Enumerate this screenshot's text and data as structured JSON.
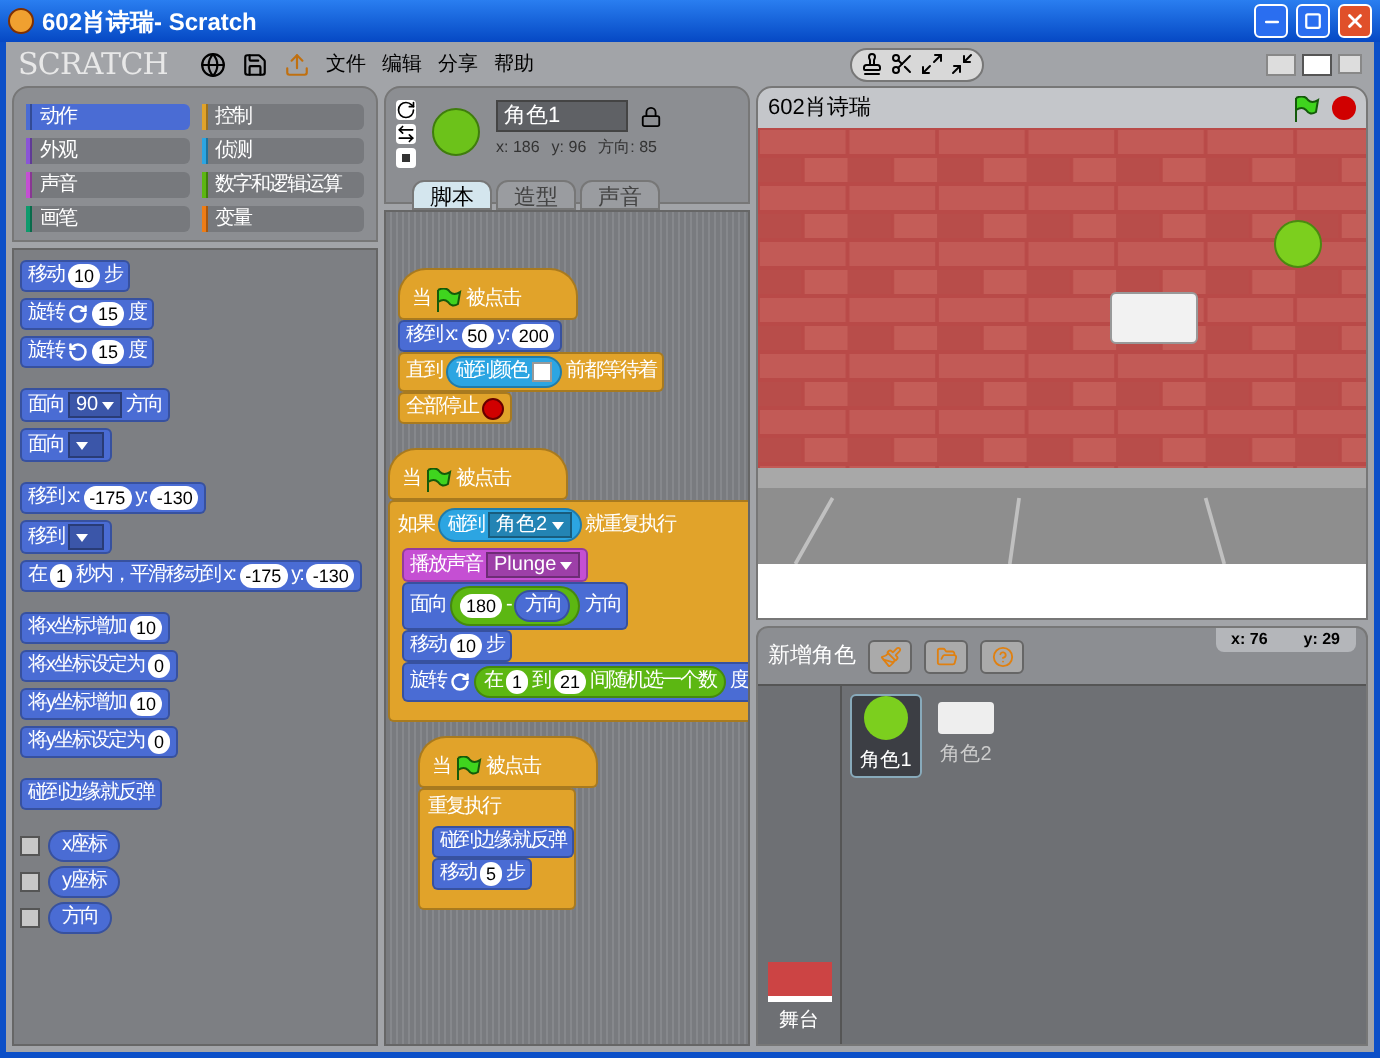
{
  "window": {
    "title": "602肖诗瑞- Scratch"
  },
  "menu_bar": {
    "logo": "SCRATCH",
    "menus": [
      "文件",
      "编辑",
      "分享",
      "帮助"
    ]
  },
  "categories": [
    {
      "label": "动作",
      "color": "#4a6cd4",
      "selected": true
    },
    {
      "label": "控制",
      "color": "#e1a32a",
      "selected": false
    },
    {
      "label": "外观",
      "color": "#8a55d7",
      "selected": false
    },
    {
      "label": "侦测",
      "color": "#2ca5e2",
      "selected": false
    },
    {
      "label": "声音",
      "color": "#c54fd3",
      "selected": false
    },
    {
      "label": "数字和逻辑运算",
      "color": "#5cb712",
      "selected": false
    },
    {
      "label": "画笔",
      "color": "#0e9a6c",
      "selected": false
    },
    {
      "label": "变量",
      "color": "#ee7d16",
      "selected": false
    }
  ],
  "palette": {
    "groups": [
      [
        {
          "kind": "stack",
          "color": "#4a6cd4",
          "parts": [
            {
              "kind": "text",
              "text": "移动"
            },
            {
              "kind": "num",
              "text": "10"
            },
            {
              "kind": "text",
              "text": "步"
            }
          ]
        },
        {
          "kind": "stack",
          "color": "#4a6cd4",
          "parts": [
            {
              "kind": "text",
              "text": "旋转"
            },
            {
              "kind": "turn_cw"
            },
            {
              "kind": "num",
              "text": "15"
            },
            {
              "kind": "text",
              "text": "度"
            }
          ]
        },
        {
          "kind": "stack",
          "color": "#4a6cd4",
          "parts": [
            {
              "kind": "text",
              "text": "旋转"
            },
            {
              "kind": "turn_ccw"
            },
            {
              "kind": "num",
              "text": "15"
            },
            {
              "kind": "text",
              "text": "度"
            }
          ]
        }
      ],
      [
        {
          "kind": "stack",
          "color": "#4a6cd4",
          "parts": [
            {
              "kind": "text",
              "text": "面向"
            },
            {
              "kind": "menu",
              "text": "90"
            },
            {
              "kind": "text",
              "text": "方向"
            }
          ]
        },
        {
          "kind": "stack",
          "color": "#4a6cd4",
          "parts": [
            {
              "kind": "text",
              "text": "面向"
            },
            {
              "kind": "menu"
            }
          ]
        }
      ],
      [
        {
          "kind": "stack",
          "color": "#4a6cd4",
          "parts": [
            {
              "kind": "text",
              "text": "移到 x:"
            },
            {
              "kind": "num",
              "text": "-175"
            },
            {
              "kind": "text",
              "text": "y:"
            },
            {
              "kind": "num",
              "text": "-130"
            }
          ]
        },
        {
          "kind": "stack",
          "color": "#4a6cd4",
          "parts": [
            {
              "kind": "text",
              "text": "移到"
            },
            {
              "kind": "menu"
            }
          ]
        },
        {
          "kind": "stack",
          "color": "#4a6cd4",
          "parts": [
            {
              "kind": "text",
              "text": "在"
            },
            {
              "kind": "num",
              "text": "1"
            },
            {
              "kind": "text",
              "text": "秒内，平滑移动到 x:"
            },
            {
              "kind": "num",
              "text": "-175"
            },
            {
              "kind": "text",
              "text": "y:"
            },
            {
              "kind": "num",
              "text": "-130"
            }
          ]
        }
      ],
      [
        {
          "kind": "stack",
          "color": "#4a6cd4",
          "parts": [
            {
              "kind": "text",
              "text": "将x坐标增加"
            },
            {
              "kind": "num",
              "text": "10"
            }
          ]
        },
        {
          "kind": "stack",
          "color": "#4a6cd4",
          "parts": [
            {
              "kind": "text",
              "text": "将x坐标设定为"
            },
            {
              "kind": "num",
              "text": "0"
            }
          ]
        },
        {
          "kind": "stack",
          "color": "#4a6cd4",
          "parts": [
            {
              "kind": "text",
              "text": "将y坐标增加"
            },
            {
              "kind": "num",
              "text": "10"
            }
          ]
        },
        {
          "kind": "stack",
          "color": "#4a6cd4",
          "parts": [
            {
              "kind": "text",
              "text": "将y坐标设定为"
            },
            {
              "kind": "num",
              "text": "0"
            }
          ]
        }
      ],
      [
        {
          "kind": "stack",
          "color": "#4a6cd4",
          "parts": [
            {
              "kind": "text",
              "text": "碰到边缘就反弹"
            }
          ]
        }
      ],
      [
        {
          "kind": "checkbox",
          "checked": false,
          "color": "#4a6cd4",
          "parts": [
            {
              "kind": "text",
              "text": "x座标"
            }
          ]
        },
        {
          "kind": "checkbox",
          "checked": false,
          "color": "#4a6cd4",
          "parts": [
            {
              "kind": "text",
              "text": "y座标"
            }
          ]
        },
        {
          "kind": "checkbox",
          "checked": false,
          "color": "#4a6cd4",
          "parts": [
            {
              "kind": "text",
              "text": "方向"
            }
          ]
        }
      ]
    ]
  },
  "sprite": {
    "name": "角色1",
    "x": "x: 186",
    "y": "y: 96",
    "direction": "方向: 85",
    "tabs": [
      {
        "label": "脚本",
        "selected": true
      },
      {
        "label": "造型",
        "selected": false
      },
      {
        "label": "声音",
        "selected": false
      }
    ]
  },
  "scripts": [
    [
      {
        "kind": "hat",
        "color": "#e1a32a",
        "parts": [
          {
            "kind": "text",
            "text": "当"
          },
          {
            "kind": "flag"
          },
          {
            "kind": "text",
            "text": "被点击"
          }
        ]
      },
      {
        "kind": "stack",
        "color": "#4a6cd4",
        "parts": [
          {
            "kind": "text",
            "text": "移到 x:"
          },
          {
            "kind": "num",
            "text": "50"
          },
          {
            "kind": "text",
            "text": "y:"
          },
          {
            "kind": "num",
            "text": "200"
          }
        ]
      },
      {
        "kind": "stack",
        "color": "#e1a32a",
        "parts": [
          {
            "kind": "text",
            "text": "直到"
          },
          {
            "kind": "reporter",
            "color": "#2ca5e2",
            "parts": [
              {
                "kind": "text",
                "text": "碰到颜色"
              },
              {
                "kind": "color",
                "color": "#ffffff"
              }
            ]
          },
          {
            "kind": "text",
            "text": "前都等待着"
          }
        ]
      },
      {
        "kind": "stack",
        "color": "#e1a32a",
        "parts": [
          {
            "kind": "text",
            "text": "全部停止"
          },
          {
            "kind": "stop"
          }
        ]
      }
    ],
    [
      {
        "kind": "hat",
        "color": "#e1a32a",
        "parts": [
          {
            "kind": "text",
            "text": "当"
          },
          {
            "kind": "flag"
          },
          {
            "kind": "text",
            "text": "被点击"
          }
        ]
      },
      {
        "kind": "c",
        "color": "#e1a32a",
        "parts": [
          {
            "kind": "text",
            "text": "如果"
          },
          {
            "kind": "reporter",
            "color": "#2ca5e2",
            "parts": [
              {
                "kind": "text",
                "text": "碰到"
              },
              {
                "kind": "menu",
                "text": "角色2"
              }
            ]
          },
          {
            "kind": "text",
            "text": "就重复执行"
          }
        ],
        "children": [
          {
            "kind": "stack",
            "color": "#c54fd3",
            "parts": [
              {
                "kind": "text",
                "text": "播放声音"
              },
              {
                "kind": "menu",
                "text": "Plunge"
              }
            ]
          },
          {
            "kind": "stack",
            "color": "#4a6cd4",
            "parts": [
              {
                "kind": "text",
                "text": "面向"
              },
              {
                "kind": "reporter",
                "color": "#5cb712",
                "parts": [
                  {
                    "kind": "num",
                    "text": "180"
                  },
                  {
                    "kind": "text",
                    "text": "-"
                  },
                  {
                    "kind": "reporter",
                    "color": "#4a6cd4",
                    "parts": [
                      {
                        "kind": "text",
                        "text": "方向"
                      }
                    ]
                  }
                ]
              },
              {
                "kind": "text",
                "text": "方向"
              }
            ]
          },
          {
            "kind": "stack",
            "color": "#4a6cd4",
            "parts": [
              {
                "kind": "text",
                "text": "移动"
              },
              {
                "kind": "num",
                "text": "10"
              },
              {
                "kind": "text",
                "text": "步"
              }
            ]
          },
          {
            "kind": "stack",
            "color": "#4a6cd4",
            "parts": [
              {
                "kind": "text",
                "text": "旋转"
              },
              {
                "kind": "turn_cw"
              },
              {
                "kind": "reporter",
                "color": "#5cb712",
                "parts": [
                  {
                    "kind": "text",
                    "text": "在"
                  },
                  {
                    "kind": "num",
                    "text": "1"
                  },
                  {
                    "kind": "text",
                    "text": "到"
                  },
                  {
                    "kind": "num",
                    "text": "21"
                  },
                  {
                    "kind": "text",
                    "text": "间随机选一个数"
                  }
                ]
              },
              {
                "kind": "text",
                "text": "度"
              }
            ]
          }
        ]
      }
    ],
    [
      {
        "kind": "hat",
        "color": "#e1a32a",
        "parts": [
          {
            "kind": "text",
            "text": "当"
          },
          {
            "kind": "flag"
          },
          {
            "kind": "text",
            "text": "被点击"
          }
        ]
      },
      {
        "kind": "c",
        "color": "#e1a32a",
        "parts": [
          {
            "kind": "text",
            "text": "重复执行"
          }
        ],
        "children": [
          {
            "kind": "stack",
            "color": "#4a6cd4",
            "parts": [
              {
                "kind": "text",
                "text": "碰到边缘就反弹"
              }
            ]
          },
          {
            "kind": "stack",
            "color": "#4a6cd4",
            "parts": [
              {
                "kind": "text",
                "text": "移动"
              },
              {
                "kind": "num",
                "text": "5"
              },
              {
                "kind": "text",
                "text": "步"
              }
            ]
          }
        ]
      }
    ]
  ],
  "stage": {
    "title": "602肖诗瑞",
    "mouse_x": "x: 76",
    "mouse_y": "y: 29"
  },
  "sprites_pane": {
    "title": "新增角色",
    "stage_label": "舞台",
    "sprites": [
      {
        "name": "角色1",
        "kind": "ball",
        "selected": true
      },
      {
        "name": "角色2",
        "kind": "panel",
        "selected": false
      }
    ]
  }
}
